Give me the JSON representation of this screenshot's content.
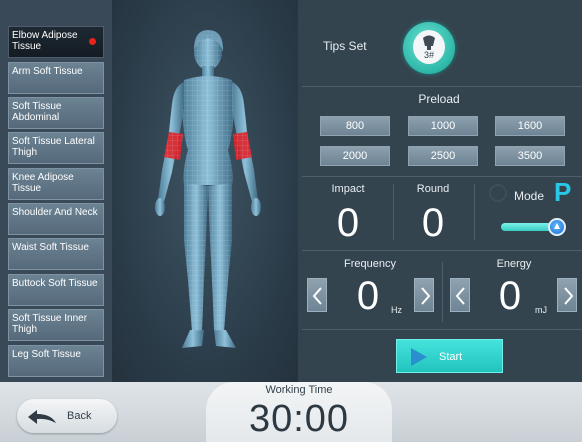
{
  "sidebar": {
    "items": [
      {
        "label": "Elbow Adipose Tissue",
        "active": true
      },
      {
        "label": "Arm Soft Tissue"
      },
      {
        "label": "Soft Tissue Abdominal"
      },
      {
        "label": "Soft Tissue Lateral Thigh"
      },
      {
        "label": "Knee Adipose Tissue"
      },
      {
        "label": "Shoulder And Neck"
      },
      {
        "label": "Waist Soft Tissue"
      },
      {
        "label": "Buttock Soft Tissue"
      },
      {
        "label": "Soft Tissue Inner Thigh"
      },
      {
        "label": "Leg Soft Tissue"
      }
    ]
  },
  "tips": {
    "label": "Tips Set",
    "value": "3#"
  },
  "preload": {
    "label": "Preload",
    "options": [
      "800",
      "1000",
      "1600",
      "2000",
      "2500",
      "3500"
    ]
  },
  "impact": {
    "label": "Impact",
    "value": "0"
  },
  "round": {
    "label": "Round",
    "value": "0"
  },
  "mode": {
    "label": "Mode",
    "value": "P"
  },
  "frequency": {
    "label": "Frequency",
    "value": "0",
    "unit": "Hz"
  },
  "energy": {
    "label": "Energy",
    "value": "0",
    "unit": "mJ"
  },
  "start": {
    "label": "Start"
  },
  "back": {
    "label": "Back"
  },
  "working_time": {
    "label": "Working Time",
    "value": "30:00"
  },
  "colors": {
    "accent": "#29c7e8",
    "highlight": "#e8231c",
    "start": "#21c4bd"
  }
}
